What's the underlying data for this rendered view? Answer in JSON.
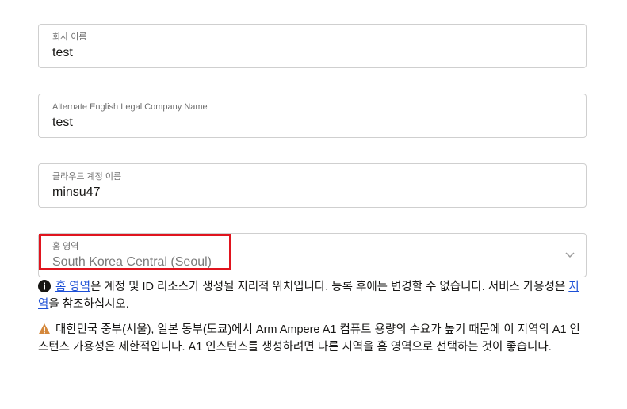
{
  "company_name": {
    "label": "회사 이름",
    "value": "test"
  },
  "alt_english_name": {
    "label": "Alternate English Legal Company Name",
    "value": "test"
  },
  "cloud_account_name": {
    "label": "클라우드 계정 이름",
    "value": "minsu47"
  },
  "home_region": {
    "label": "홈 영역",
    "value": "South Korea Central (Seoul)",
    "icon": "chevron-down-icon"
  },
  "info_note": {
    "icon": "info-icon",
    "link_home_region": "홈 영역",
    "text_1": "은 계정 및 ID 리소스가 생성될 지리적 위치입니다. 등록 후에는 변경할 수 없습니다. 서비스 가용성은 ",
    "link_regions": "지역",
    "text_2": "을 참조하십시오."
  },
  "warning_note": {
    "icon": "warning-icon",
    "text": "대한민국 중부(서울), 일본 동부(도쿄)에서 Arm Ampere A1 컴퓨트 용량의 수요가 높기 때문에 이 지역의 A1 인스턴스 가용성은 제한적입니다. A1 인스턴스를 생성하려면 다른 지역을 홈 영역으로 선택하는 것이 좋습니다."
  },
  "colors": {
    "highlight_border": "#e0141e",
    "link": "#1c4fd6",
    "warning": "#d4883c",
    "info": "#161513"
  }
}
